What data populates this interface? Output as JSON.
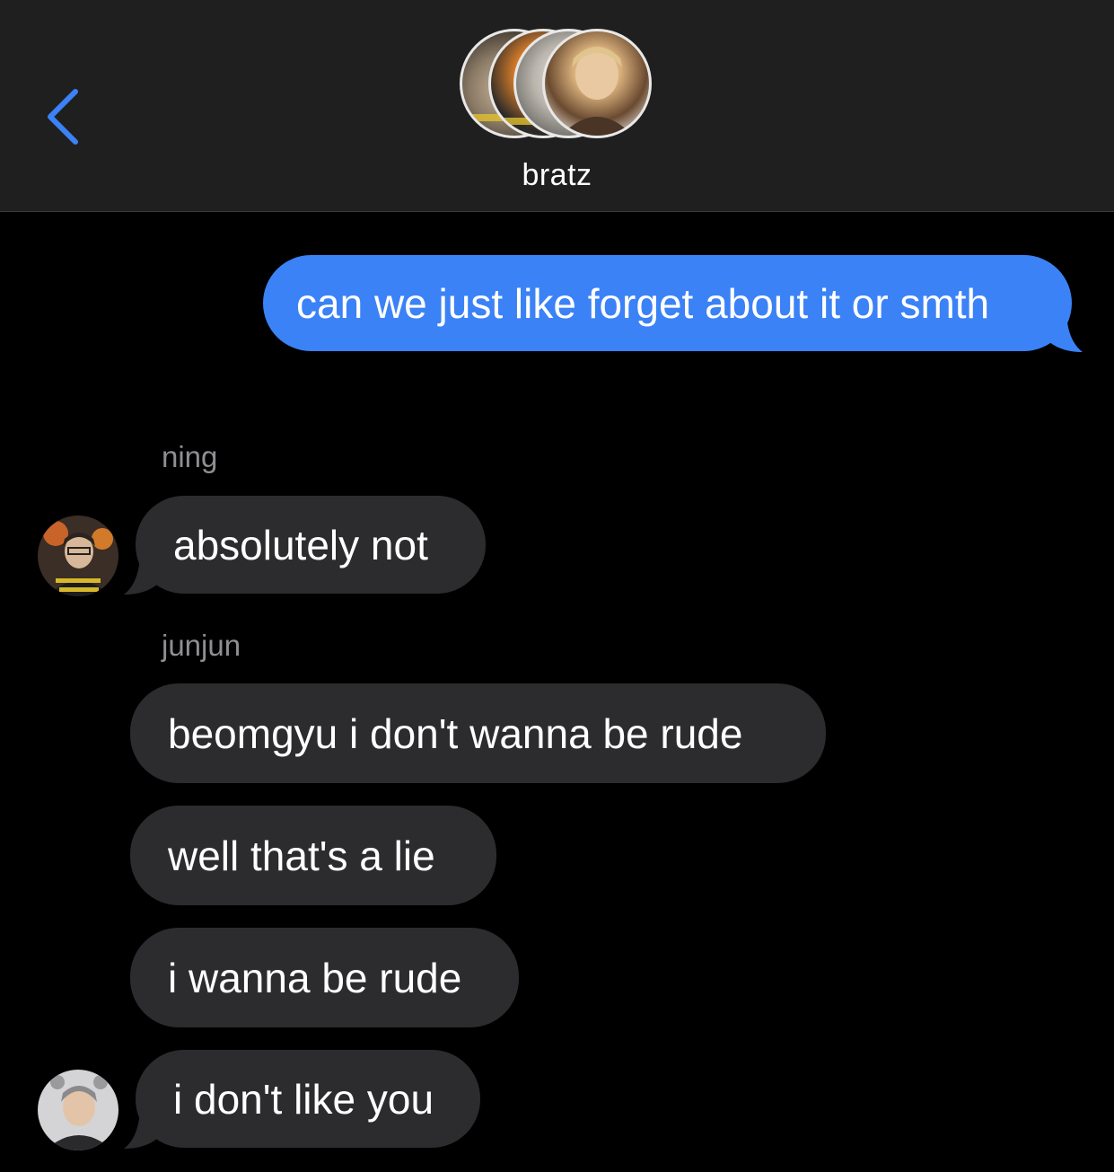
{
  "header": {
    "back_icon": "chevron-left-icon",
    "group_name": "bratz",
    "accent_color": "#3b82f6"
  },
  "messages": {
    "sent": [
      {
        "text": "can we just like forget about it or smth"
      }
    ],
    "groups": [
      {
        "sender": "ning",
        "avatar": "ning-avatar",
        "bubbles": [
          {
            "text": "absolutely not"
          }
        ]
      },
      {
        "sender": "junjun",
        "avatar": "junjun-avatar",
        "bubbles": [
          {
            "text": "beomgyu i don't wanna be rude"
          },
          {
            "text": "well that's a lie"
          },
          {
            "text": "i wanna be rude"
          },
          {
            "text": "i don't like you"
          }
        ]
      }
    ]
  },
  "colors": {
    "sent_bubble": "#3b82f6",
    "received_bubble": "#2c2c2e",
    "header_bg": "#1f1f1f",
    "background": "#000000"
  }
}
